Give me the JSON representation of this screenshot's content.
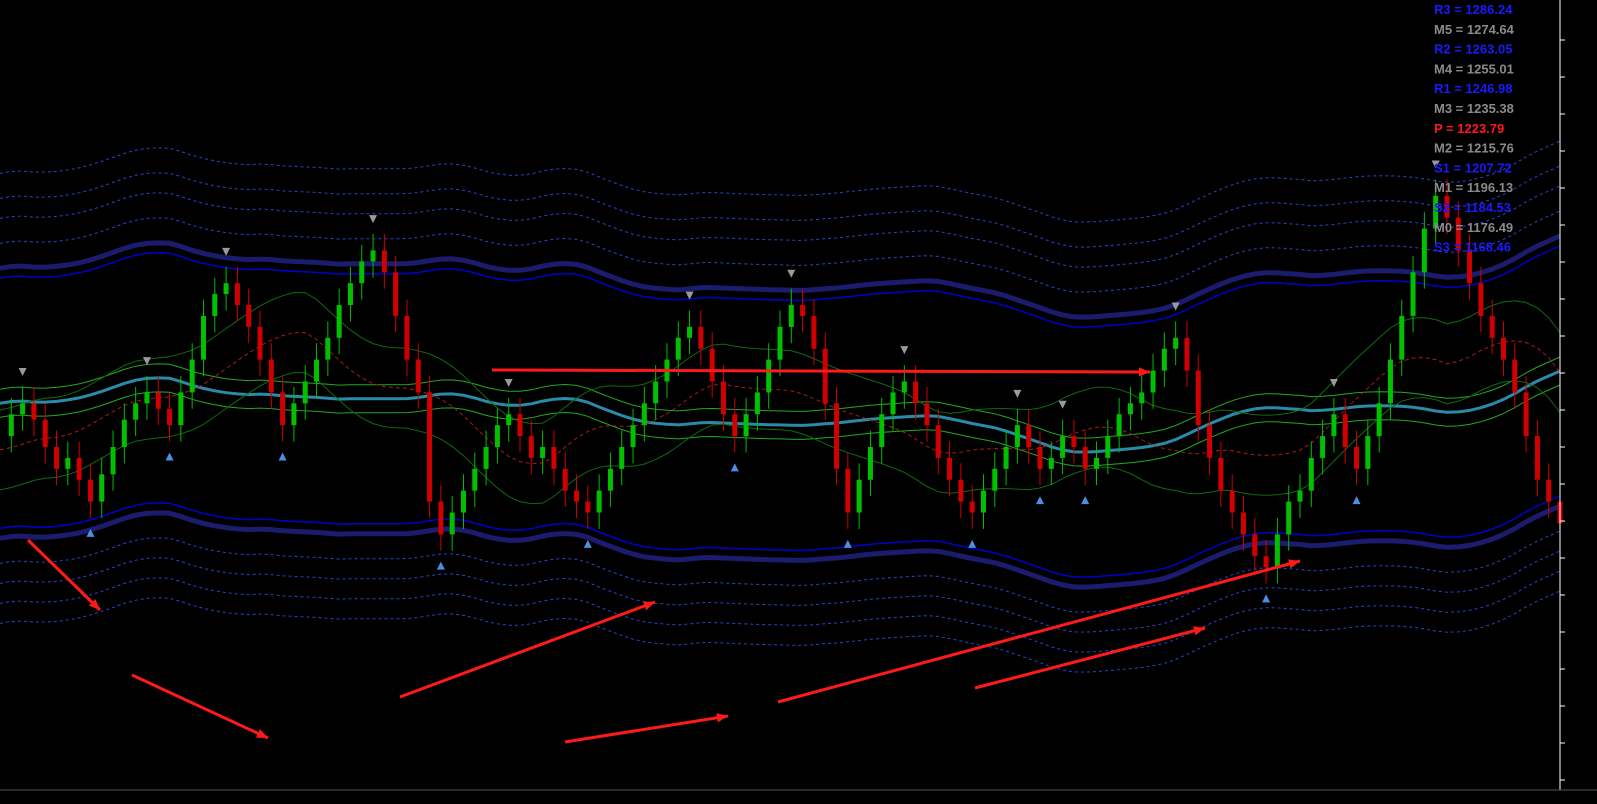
{
  "chart_data": {
    "type": "line",
    "title": "",
    "background": "#000000",
    "pivot_levels": [
      {
        "label": "R3 = 1286.24",
        "kind": "resistance",
        "value": 1286.24,
        "color": "#1a1aff"
      },
      {
        "label": "M5 = 1274.64",
        "kind": "mid",
        "value": 1274.64,
        "color": "#8a8a8a"
      },
      {
        "label": "R2 = 1263.05",
        "kind": "resistance",
        "value": 1263.05,
        "color": "#1a1aff"
      },
      {
        "label": "M4 = 1255.01",
        "kind": "mid",
        "value": 1255.01,
        "color": "#8a8a8a"
      },
      {
        "label": "R1 = 1246.98",
        "kind": "resistance",
        "value": 1246.98,
        "color": "#1a1aff"
      },
      {
        "label": "M3 = 1235.38",
        "kind": "mid",
        "value": 1235.38,
        "color": "#8a8a8a"
      },
      {
        "label": "P = 1223.79",
        "kind": "pivot",
        "value": 1223.79,
        "color": "#ff1a1a"
      },
      {
        "label": "M2 = 1215.76",
        "kind": "mid",
        "value": 1215.76,
        "color": "#8a8a8a"
      },
      {
        "label": "S1 = 1207.72",
        "kind": "support",
        "value": 1207.72,
        "color": "#1a1aff"
      },
      {
        "label": "M1 = 1196.13",
        "kind": "mid",
        "value": 1196.13,
        "color": "#8a8a8a"
      },
      {
        "label": "S2 = 1184.53",
        "kind": "support",
        "value": 1184.53,
        "color": "#1a1aff"
      },
      {
        "label": "M0 = 1176.49",
        "kind": "mid",
        "value": 1176.49,
        "color": "#8a8a8a"
      },
      {
        "label": "S3 = 1168.46",
        "kind": "support",
        "value": 1168.46,
        "color": "#1a1aff"
      }
    ],
    "price_series": {
      "values": [
        0.52,
        0.56,
        0.58,
        0.55,
        0.5,
        0.46,
        0.48,
        0.44,
        0.4,
        0.45,
        0.5,
        0.55,
        0.58,
        0.6,
        0.57,
        0.54,
        0.6,
        0.66,
        0.74,
        0.78,
        0.8,
        0.76,
        0.72,
        0.66,
        0.6,
        0.54,
        0.58,
        0.62,
        0.66,
        0.7,
        0.76,
        0.8,
        0.84,
        0.86,
        0.82,
        0.74,
        0.66,
        0.6,
        0.4,
        0.34,
        0.38,
        0.42,
        0.46,
        0.5,
        0.54,
        0.56,
        0.52,
        0.48,
        0.5,
        0.46,
        0.42,
        0.4,
        0.38,
        0.42,
        0.46,
        0.5,
        0.54,
        0.58,
        0.62,
        0.66,
        0.7,
        0.72,
        0.68,
        0.62,
        0.56,
        0.52,
        0.56,
        0.6,
        0.66,
        0.72,
        0.76,
        0.74,
        0.68,
        0.58,
        0.46,
        0.38,
        0.44,
        0.5,
        0.56,
        0.6,
        0.62,
        0.58,
        0.54,
        0.48,
        0.44,
        0.4,
        0.38,
        0.42,
        0.46,
        0.5,
        0.54,
        0.5,
        0.46,
        0.48,
        0.52,
        0.5,
        0.46,
        0.48,
        0.52,
        0.56,
        0.58,
        0.6,
        0.64,
        0.68,
        0.7,
        0.64,
        0.54,
        0.48,
        0.42,
        0.38,
        0.34,
        0.3,
        0.28,
        0.34,
        0.4,
        0.42,
        0.48,
        0.52,
        0.56,
        0.5,
        0.46,
        0.52,
        0.58,
        0.66,
        0.74,
        0.82,
        0.9,
        0.96,
        0.92,
        0.86,
        0.8,
        0.74,
        0.7,
        0.66,
        0.6,
        0.52,
        0.44,
        0.4,
        0.36
      ],
      "colors": {
        "up": "#00c000",
        "down": "#d00000"
      }
    },
    "annotations": [
      {
        "type": "arrow",
        "description": "trend arrow",
        "color": "#ff1a1a"
      }
    ]
  }
}
